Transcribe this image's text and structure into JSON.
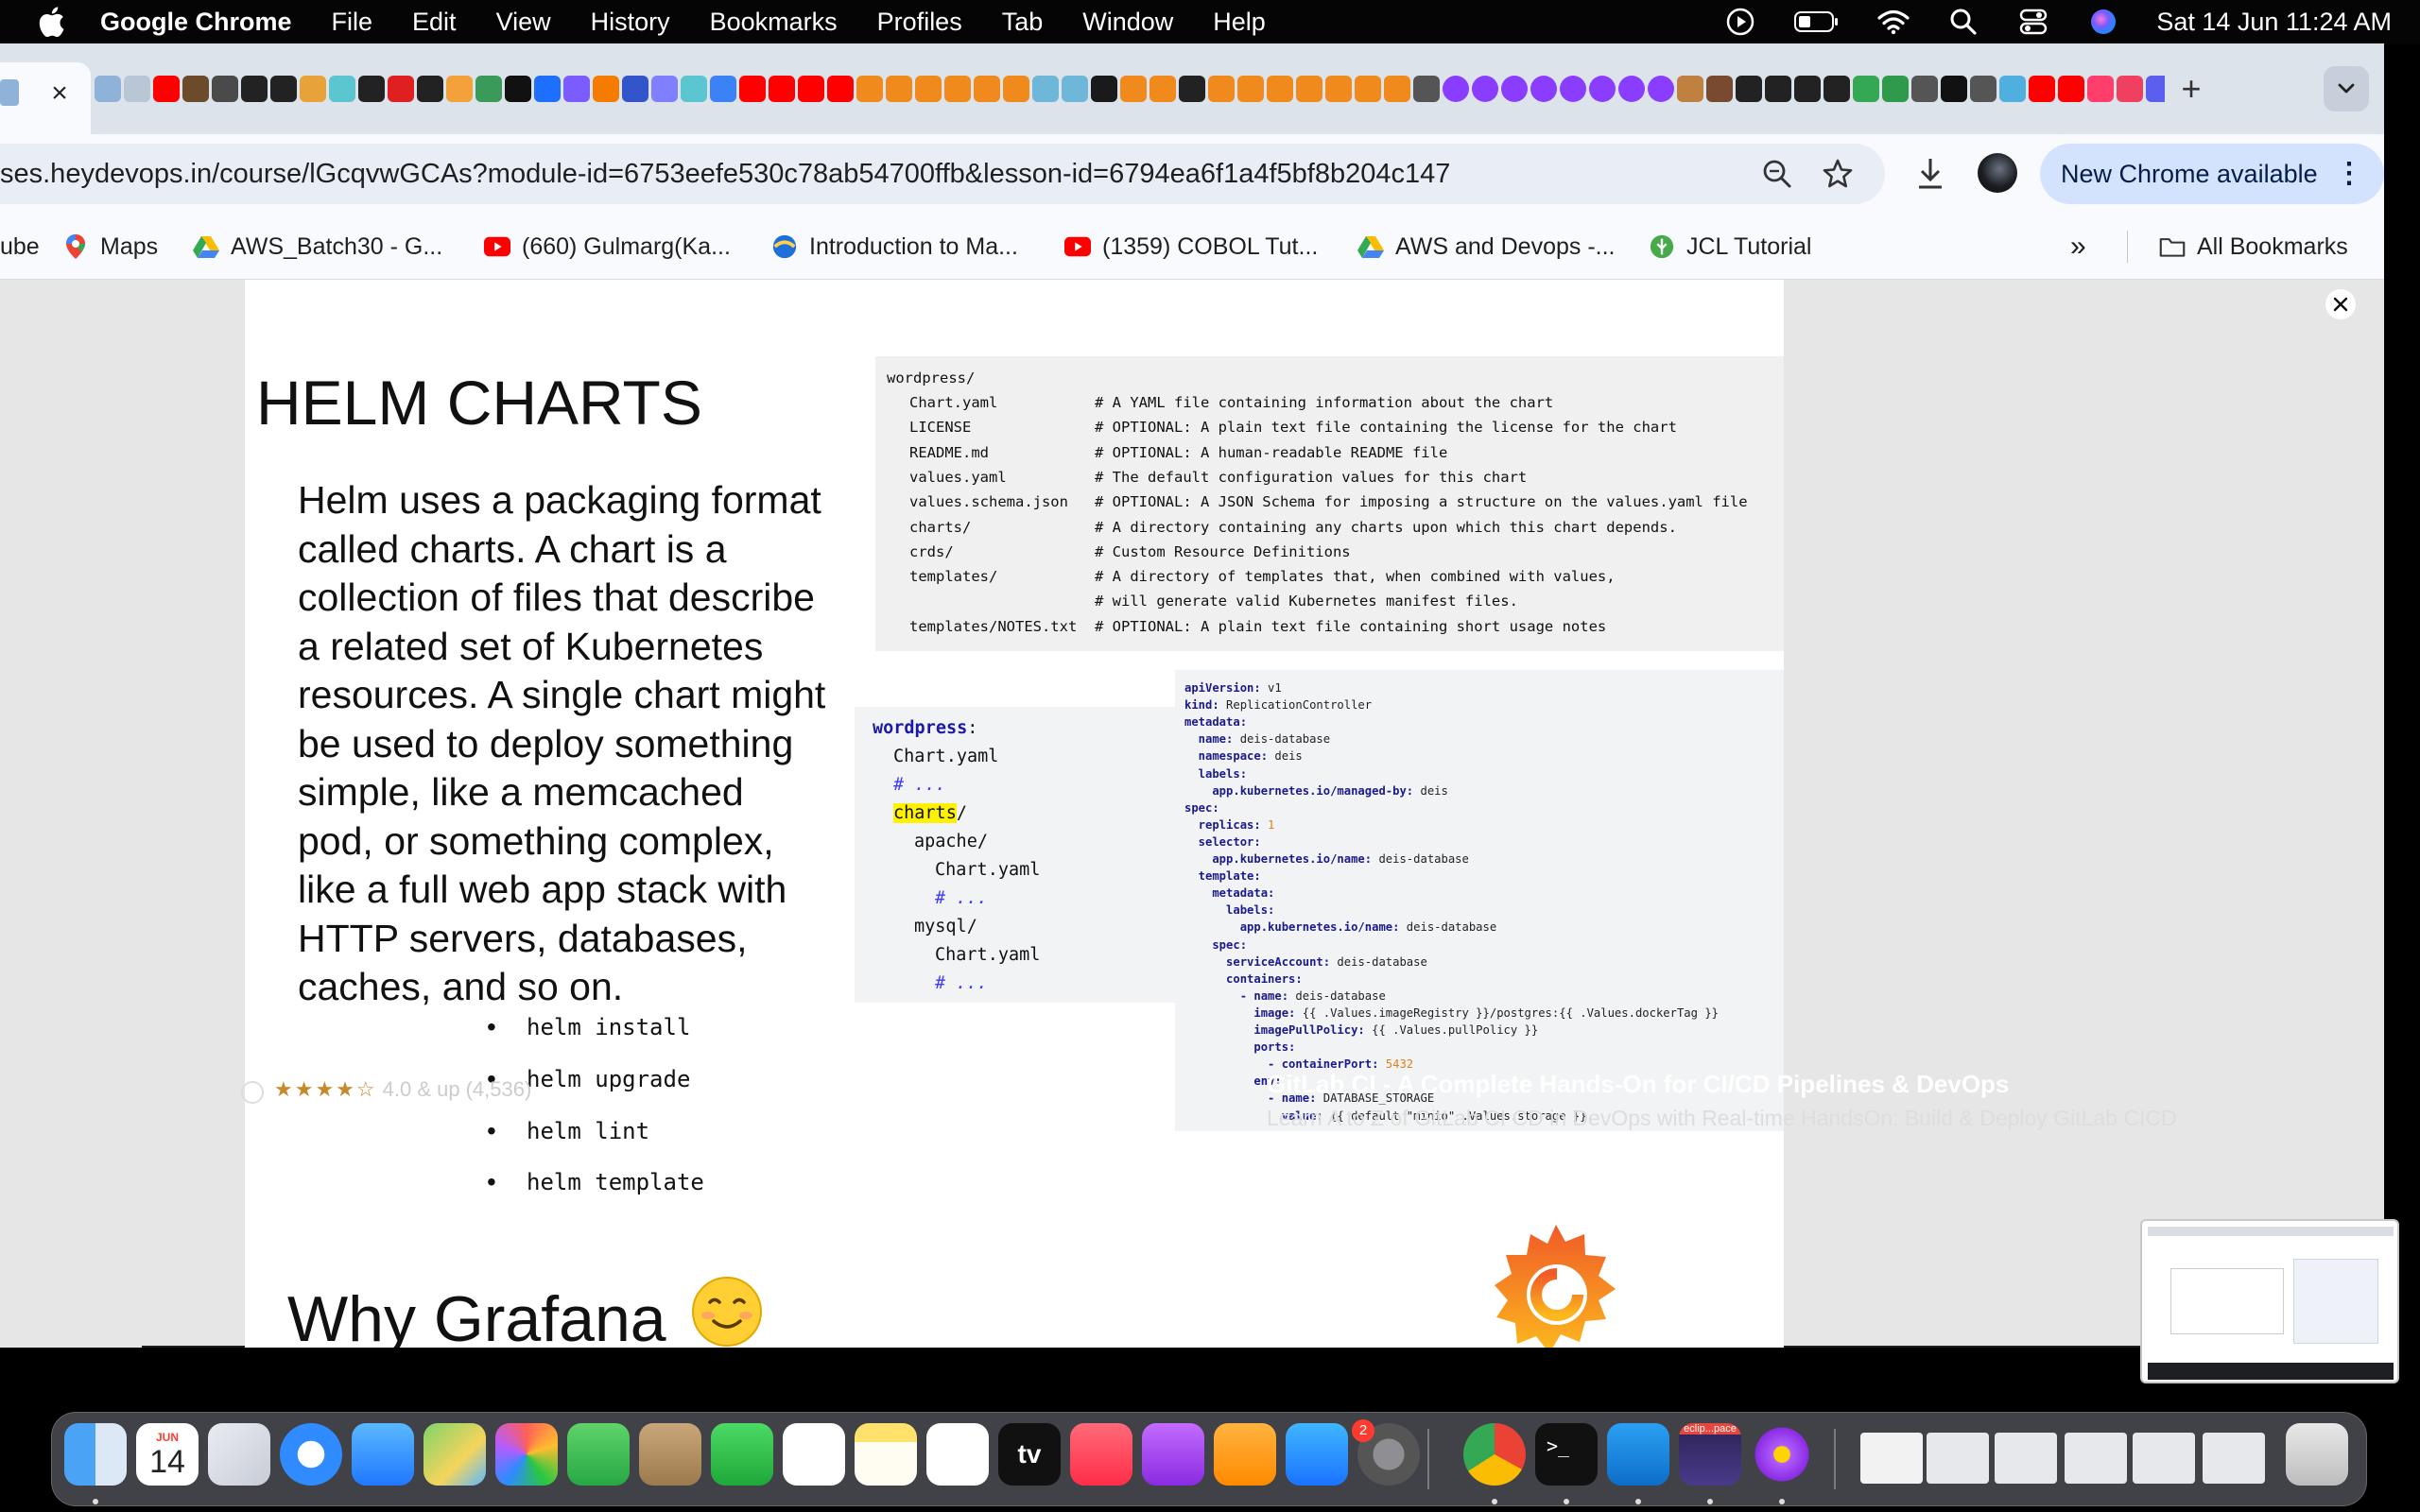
{
  "menubar": {
    "app_name": "Google Chrome",
    "menus": [
      "File",
      "Edit",
      "View",
      "History",
      "Bookmarks",
      "Profiles",
      "Tab",
      "Window",
      "Help"
    ],
    "clock": "Sat 14 Jun  11:24 AM",
    "status_icons": [
      "play-circle-icon",
      "battery-icon",
      "wifi-icon",
      "spotlight-search-icon",
      "control-center-icon",
      "siri-icon"
    ]
  },
  "browser": {
    "url": "ses.heydevops.in/course/lGcqvwGCAs?module-id=6753eefe530c78ab54700ffb&lesson-id=6794ea6f1a4f5bf8b204c147",
    "update_button": "New Chrome available",
    "bookmarks": [
      {
        "label": "ube",
        "icon": "youtube-icon"
      },
      {
        "label": "Maps",
        "icon": "maps-icon"
      },
      {
        "label": "AWS_Batch30 - G...",
        "icon": "google-drive-icon"
      },
      {
        "label": "(660) Gulmarg(Ka...",
        "icon": "youtube-icon"
      },
      {
        "label": "Introduction to Ma...",
        "icon": "ibm-icon"
      },
      {
        "label": "(1359) COBOL Tut...",
        "icon": "youtube-icon"
      },
      {
        "label": "AWS and Devops -...",
        "icon": "google-drive-icon"
      },
      {
        "label": "JCL Tutorial",
        "icon": "leaf-icon"
      }
    ],
    "more_bookmarks": "»",
    "all_bookmarks": "All Bookmarks"
  },
  "slide": {
    "title": "HELM CHARTS",
    "paragraph": "Helm uses a packaging format called charts. A chart is a collection of files that describe a related set of Kubernetes resources. A single chart might be used to deploy something simple, like a memcached pod, or something complex, like a full web app stack with HTTP servers, databases, caches, and so on.",
    "commands": [
      "helm install",
      "helm upgrade",
      "helm lint",
      "helm template"
    ],
    "tree_root": "wordpress/",
    "tree": [
      {
        "file": "Chart.yaml",
        "comment": "# A YAML file containing information about the chart"
      },
      {
        "file": "LICENSE",
        "comment": "# OPTIONAL: A plain text file containing the license for the chart"
      },
      {
        "file": "README.md",
        "comment": "# OPTIONAL: A human-readable README file"
      },
      {
        "file": "values.yaml",
        "comment": "# The default configuration values for this chart"
      },
      {
        "file": "values.schema.json",
        "comment": "# OPTIONAL: A JSON Schema for imposing a structure on the values.yaml file"
      },
      {
        "file": "charts/",
        "comment": "# A directory containing any charts upon which this chart depends."
      },
      {
        "file": "crds/",
        "comment": "# Custom Resource Definitions"
      },
      {
        "file": "templates/",
        "comment": "# A directory of templates that, when combined with values,"
      },
      {
        "file": "",
        "comment": "# will generate valid Kubernetes manifest files."
      },
      {
        "file": "templates/NOTES.txt",
        "comment": "# OPTIONAL: A plain text file containing short usage notes"
      }
    ],
    "wp_tree": {
      "root": "wordpress",
      "root_colon": ":",
      "chart": "Chart.yaml",
      "ellipsis": "# ...",
      "charts": "charts",
      "slash": "/",
      "apache": "apache/",
      "mysql": "mysql/"
    },
    "yaml": [
      {
        "k": "apiVersion:",
        "v": " v1"
      },
      {
        "k": "kind:",
        "v": " ReplicationController"
      },
      {
        "k": "metadata:",
        "v": ""
      },
      {
        "k": "  name:",
        "v": " deis-database"
      },
      {
        "k": "  namespace:",
        "v": " deis"
      },
      {
        "k": "  labels:",
        "v": ""
      },
      {
        "k": "    app.kubernetes.io/managed-by:",
        "v": " deis"
      },
      {
        "k": "spec:",
        "v": ""
      },
      {
        "k": "  replicas:",
        "v": " 1"
      },
      {
        "k": "  selector:",
        "v": ""
      },
      {
        "k": "    app.kubernetes.io/name:",
        "v": " deis-database"
      },
      {
        "k": "  template:",
        "v": ""
      },
      {
        "k": "    metadata:",
        "v": ""
      },
      {
        "k": "      labels:",
        "v": ""
      },
      {
        "k": "        app.kubernetes.io/name:",
        "v": " deis-database"
      },
      {
        "k": "    spec:",
        "v": ""
      },
      {
        "k": "      serviceAccount:",
        "v": " deis-database"
      },
      {
        "k": "      containers:",
        "v": ""
      },
      {
        "k": "        - name:",
        "v": " deis-database"
      },
      {
        "k": "          image:",
        "v": " {{ .Values.imageRegistry }}/postgres:{{ .Values.dockerTag }}"
      },
      {
        "k": "          imagePullPolicy:",
        "v": " {{ .Values.pullPolicy }}"
      },
      {
        "k": "          ports:",
        "v": ""
      },
      {
        "k": "            - containerPort:",
        "v": " 5432"
      },
      {
        "k": "          env:",
        "v": ""
      },
      {
        "k": "            - name:",
        "v": " DATABASE_STORAGE"
      },
      {
        "k": "              value:",
        "v": " {{ default \"minio\" .Values.storage }}"
      }
    ],
    "title2": "Why Grafana",
    "title2_emoji": "☺️"
  },
  "background_page": {
    "rating_label": "4.0 & up",
    "rating_count": "(4,536)",
    "rating_stars": "★★★★☆",
    "course_title": "GitLab CI - A Complete Hands-On for CI/CD Pipelines & DevOps",
    "course_subtitle": "Learn A to Z of GitLab CI CD in DevOps with Real-time HandsOn: Build & Deploy GitLab CICD"
  },
  "dock": {
    "calendar_month": "JUN",
    "calendar_day": "14",
    "system_settings_badge": "2",
    "eclipse_label": "eclip...pace",
    "apple_tv_label": "tv",
    "apps": [
      "finder-icon",
      "calendar-icon",
      "launchpad-icon",
      "safari-icon",
      "mail-icon",
      "maps-icon",
      "photos-icon",
      "facetime-icon",
      "contacts-icon",
      "numbers-icon",
      "reminders-icon",
      "notes-icon",
      "freeform-icon",
      "apple-tv-icon",
      "music-icon",
      "podcasts-icon",
      "pages-icon",
      "app-store-icon",
      "system-settings-icon",
      "chrome-icon",
      "terminal-icon",
      "vscode-icon",
      "eclipse-icon",
      "flower-app-icon",
      "document-icon",
      "window-thumb-icon",
      "window-thumb-icon",
      "window-thumb-icon",
      "window-thumb-icon",
      "window-thumb-icon",
      "trash-icon"
    ]
  },
  "colors": {
    "menubar_bg": "#050505",
    "chrome_frame": "#dde3ea",
    "toolbar": "#f8fafd",
    "omnibox": "#e9eef6",
    "update_button": "#d3e3fd",
    "code_bg": "#f0f0f0",
    "yaml_key": "#1a1a8c",
    "highlight": "#fff200",
    "grafana_orange": "#f05a28"
  }
}
